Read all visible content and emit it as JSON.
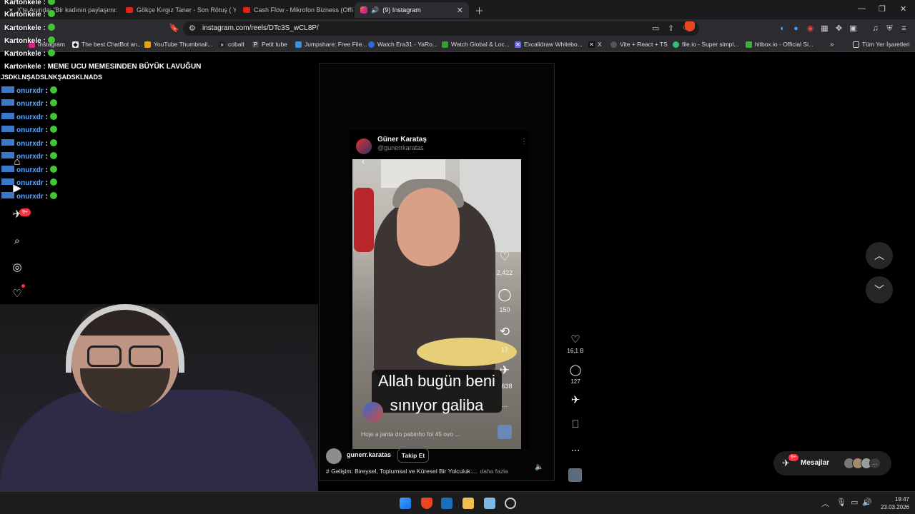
{
  "tabs": [
    {
      "label": "X'te Anında: \"Bir kadının paylaşımı: \"",
      "active": false
    },
    {
      "label": "Gökçe Kırgız Taner - Son Rötuş ( Y-En",
      "active": false
    },
    {
      "label": "Cash Flow - Mikrofon Bizness (Officia",
      "active": false
    },
    {
      "label": "(9) Instagram",
      "active": true
    }
  ],
  "address": {
    "url": "instagram.com/reels/DTc3S_wCL8P/"
  },
  "bookmarks": [
    "Instagram",
    "The best ChatBot an...",
    "YouTube Thumbnail...",
    "cobalt",
    "Petit tube",
    "Jumpshare: Free File...",
    "Watch Era31 - YaRo...",
    "Watch Global & Loc...",
    "Excalidraw Whitebo...",
    "X",
    "Vite + React + TS",
    "file.io - Super simpl...",
    "hitbox.io - Official Si..."
  ],
  "bookmarks_all": "Tüm Yer İşaretleri",
  "sidebar": {
    "notif_badge": "9+"
  },
  "chat": {
    "lines": [
      {
        "user": "Kartonkele",
        "sep": ":"
      },
      {
        "user": "Kartonkele",
        "sep": ":"
      },
      {
        "user": "Kartonkele",
        "sep": ":"
      },
      {
        "user": "Kartonkele",
        "sep": ":"
      },
      {
        "user": "Kartonkele",
        "sep": ":"
      }
    ],
    "message_user": "Kartonkele",
    "message_text": ": MEME UCU MEMESINDEN BÜYÜK LAVUĞUN",
    "message_cont": "JSDKLNŞADSLNKŞADSKLNADS",
    "onur_lines": [
      "onurxdr",
      "onurxdr",
      "onurxdr",
      "onurxdr",
      "onurxdr",
      "onurxdr",
      "onurxdr",
      "onurxdr",
      "onurxdr"
    ]
  },
  "post": {
    "author_name": "Güner Karataş",
    "author_handle": "@gunerrkaratas",
    "caption_line1": "Allah bugün beni",
    "caption_line2": "sınıyor galiba",
    "inner_likes": "2,422",
    "inner_comments": "150",
    "inner_reposts": "17",
    "inner_shares": "638",
    "inner_more": "...",
    "inner_bottom_text": "Hoje a janta do pabinho foi 45 ovo ..."
  },
  "reel": {
    "username": "gunerr.karatas",
    "follow_label": "Takip Et",
    "description": "# Gelişim: Bireysel, Toplumsal ve Küresel Bir Yolculuk ...",
    "more_label": "daha fazla",
    "likes": "16,1 B",
    "comments": "127",
    "more": "..."
  },
  "messages": {
    "label": "Mesajlar",
    "badge": "9+"
  },
  "taskbar": {
    "time": "19:47",
    "date": "23.03.2026"
  },
  "colors": {
    "accent_red": "#ff3040",
    "brave_orange": "#e8461f",
    "emote_green": "#43c436",
    "chat_blue": "#58a6ff"
  }
}
